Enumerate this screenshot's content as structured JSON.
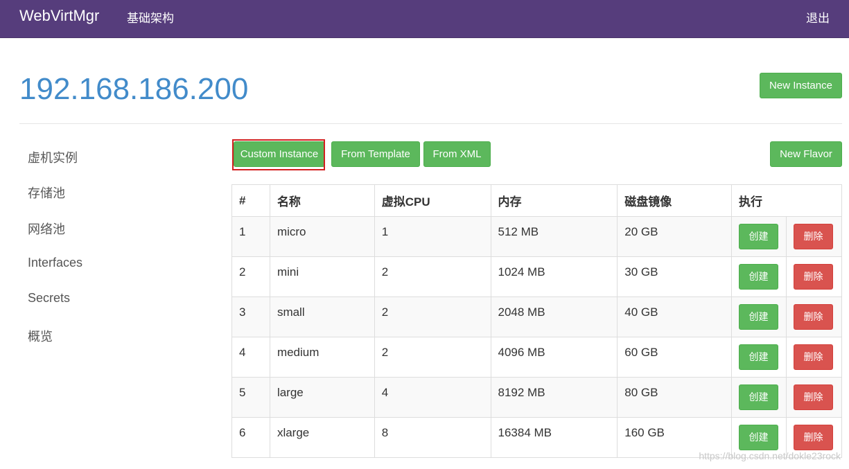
{
  "navbar": {
    "brand": "WebVirtMgr",
    "nav_link": "基础架构",
    "logout": "退出"
  },
  "host": {
    "title": "192.168.186.200"
  },
  "buttons": {
    "new_instance": "New Instance",
    "custom_instance": "Custom Instance",
    "from_template": "From Template",
    "from_xml": "From XML",
    "new_flavor": "New Flavor"
  },
  "sidebar": {
    "items": [
      {
        "label": "虚机实例"
      },
      {
        "label": "存储池"
      },
      {
        "label": "网络池"
      },
      {
        "label": "Interfaces"
      },
      {
        "label": "Secrets"
      },
      {
        "label": "概览"
      }
    ]
  },
  "table": {
    "headers": [
      "#",
      "名称",
      "虚拟CPU",
      "内存",
      "磁盘镜像",
      "执行"
    ],
    "rows": [
      [
        "1",
        "micro",
        "1",
        "512 MB",
        "20 GB"
      ],
      [
        "2",
        "mini",
        "2",
        "1024 MB",
        "30 GB"
      ],
      [
        "3",
        "small",
        "2",
        "2048 MB",
        "40 GB"
      ],
      [
        "4",
        "medium",
        "2",
        "4096 MB",
        "60 GB"
      ],
      [
        "5",
        "large",
        "4",
        "8192 MB",
        "80 GB"
      ],
      [
        "6",
        "xlarge",
        "8",
        "16384 MB",
        "160 GB"
      ]
    ],
    "create_label": "创建",
    "delete_label": "删除"
  },
  "watermark": "https://blog.csdn.net/dokle23rock",
  "colors": {
    "navbar": "#563d7c",
    "title": "#428bca",
    "success": "#5cb85c",
    "danger": "#d9534f"
  }
}
